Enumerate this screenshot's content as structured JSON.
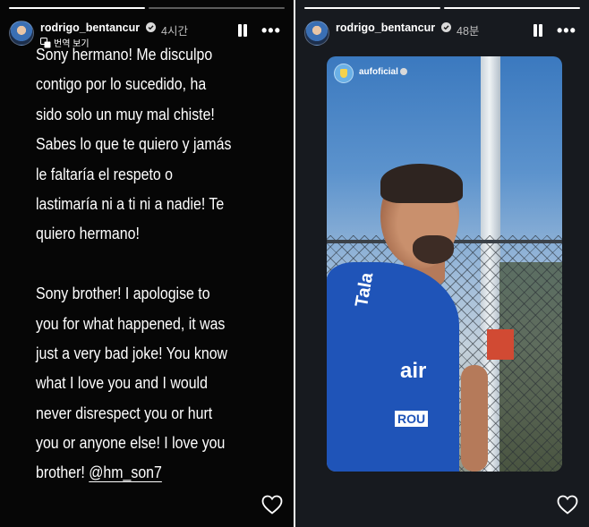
{
  "left_story": {
    "progress": [
      1.0,
      0.0
    ],
    "user": {
      "username": "rodrigo_bentancur",
      "timestamp": "4시간",
      "translate_label": "번역 보기"
    },
    "message_lines": [
      "Sony hermano! Me disculpo",
      "contigo por lo sucedido, ha",
      "sido solo un muy mal chiste!",
      "Sabes lo que te quiero y jamás",
      "le faltaría el respeto o",
      "lastimaría ni a ti ni a nadie! Te",
      "quiero hermano!",
      "",
      "Sony brother! I apologise to",
      "you for what happened, it was",
      "just a very bad joke! You know",
      "what I love you and I would",
      "never disrespect you or hurt",
      "you or anyone else! I love you"
    ],
    "last_line_prefix": "brother! ",
    "mention": "@hm_son7"
  },
  "right_story": {
    "progress": [
      1.0,
      1.0
    ],
    "user": {
      "username": "rodrigo_bentancur",
      "timestamp": "48분"
    },
    "post": {
      "username": "aufoficial",
      "shirt_texts": [
        "Tala",
        "air",
        "ROU"
      ]
    }
  },
  "icons": [
    "verified-badge-icon",
    "translate-icon",
    "pause-icon",
    "more-icon",
    "heart-icon"
  ],
  "colors": {
    "story_bg_left": "#060606",
    "story_bg_right": "#171a1f",
    "text": "#ffffff",
    "muted": "#bdbdbd",
    "shirt_blue": "#1f54b8"
  }
}
